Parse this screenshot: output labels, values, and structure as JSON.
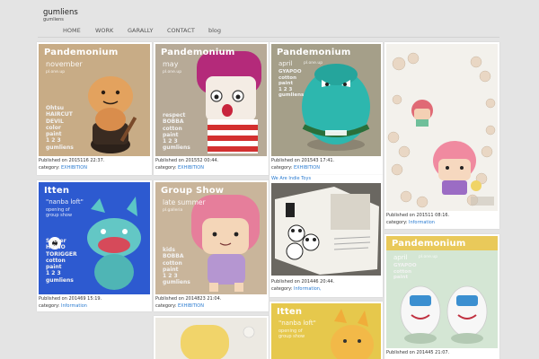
{
  "site": {
    "title": "gumliens",
    "subtitle": "gumliens"
  },
  "nav": [
    "HOME",
    "WORK",
    "GARALLY",
    "CONTACT",
    "blog"
  ],
  "cards": {
    "c1": {
      "title": "Pandemonium",
      "sub": "november",
      "small": "pl.one.up",
      "lines": "Ohtsu\nHAIRCUT\nDEVIL\ncolor\npaint\n1 2 3\ngumliens",
      "published": "Published on 2015116 22:37.",
      "category_label": "category:",
      "category": "EXHIBITION"
    },
    "c2": {
      "title": "Pandemonium",
      "sub": "may",
      "small": "pl.one.up",
      "lines": "respect\nBOBBA\ncotton\npaint\n1 2 3\ngumliens",
      "published": "Published on 201552 00:44.",
      "category_label": "category:",
      "category": "EXHIBITION"
    },
    "c3": {
      "title": "Pandemonium",
      "sub": "april",
      "small": "pl.one.up",
      "lines": "GYAPOO\ncotton\npaint\n1 2 3\ngumliens",
      "published": "Published on 201543 17:41.",
      "category_label": "category:",
      "category": "EXHIBITION"
    },
    "c4": {
      "published": "Published on 201511 08:16.",
      "category_label": "category:",
      "category": "Information"
    },
    "c5": {
      "title": "Itten",
      "sub": "\"nanba loft\"",
      "sub2": "opening of group show",
      "lines": "Soccer\nHIPNO\nTORIGGER\ncotton\npaint\n1 2 3\ngumliens",
      "published": "Published on 201469 15:19.",
      "category_label": "category:",
      "category": "Information"
    },
    "c6": {
      "title": "Group Show",
      "sub": "late summer",
      "small": "pl.galleria",
      "lines": "kids\nBOBBA\ncotton\npaint\n1 2 3\ngumliens",
      "published": "Published on 2014823 21:04.",
      "category_label": "category:",
      "category": "EXHIBITION"
    },
    "c7": {
      "head": "We Are Indie Toys",
      "published": "Published on 201446 20:44.",
      "category_label": "category:",
      "category": "Information,"
    },
    "c8": {
      "title": "Pandemonium",
      "sub": "april",
      "small": "pl.one.up",
      "lines": "GYAPOO\ncotton\npaint",
      "published": "Published on 201445 21:07.",
      "category_label": "category:",
      "category": "Information"
    },
    "c10": {
      "title": "Itten",
      "sub": "\"nanba loft\"",
      "sub2": "opening of group show"
    }
  },
  "colors": {
    "page_bg": "#e4e4e4",
    "link": "#2a7bd0",
    "tan": "#c9ad8a",
    "blue": "#2f5fd0",
    "mustard": "#e6c94f",
    "mint": "#d6e8d6"
  }
}
